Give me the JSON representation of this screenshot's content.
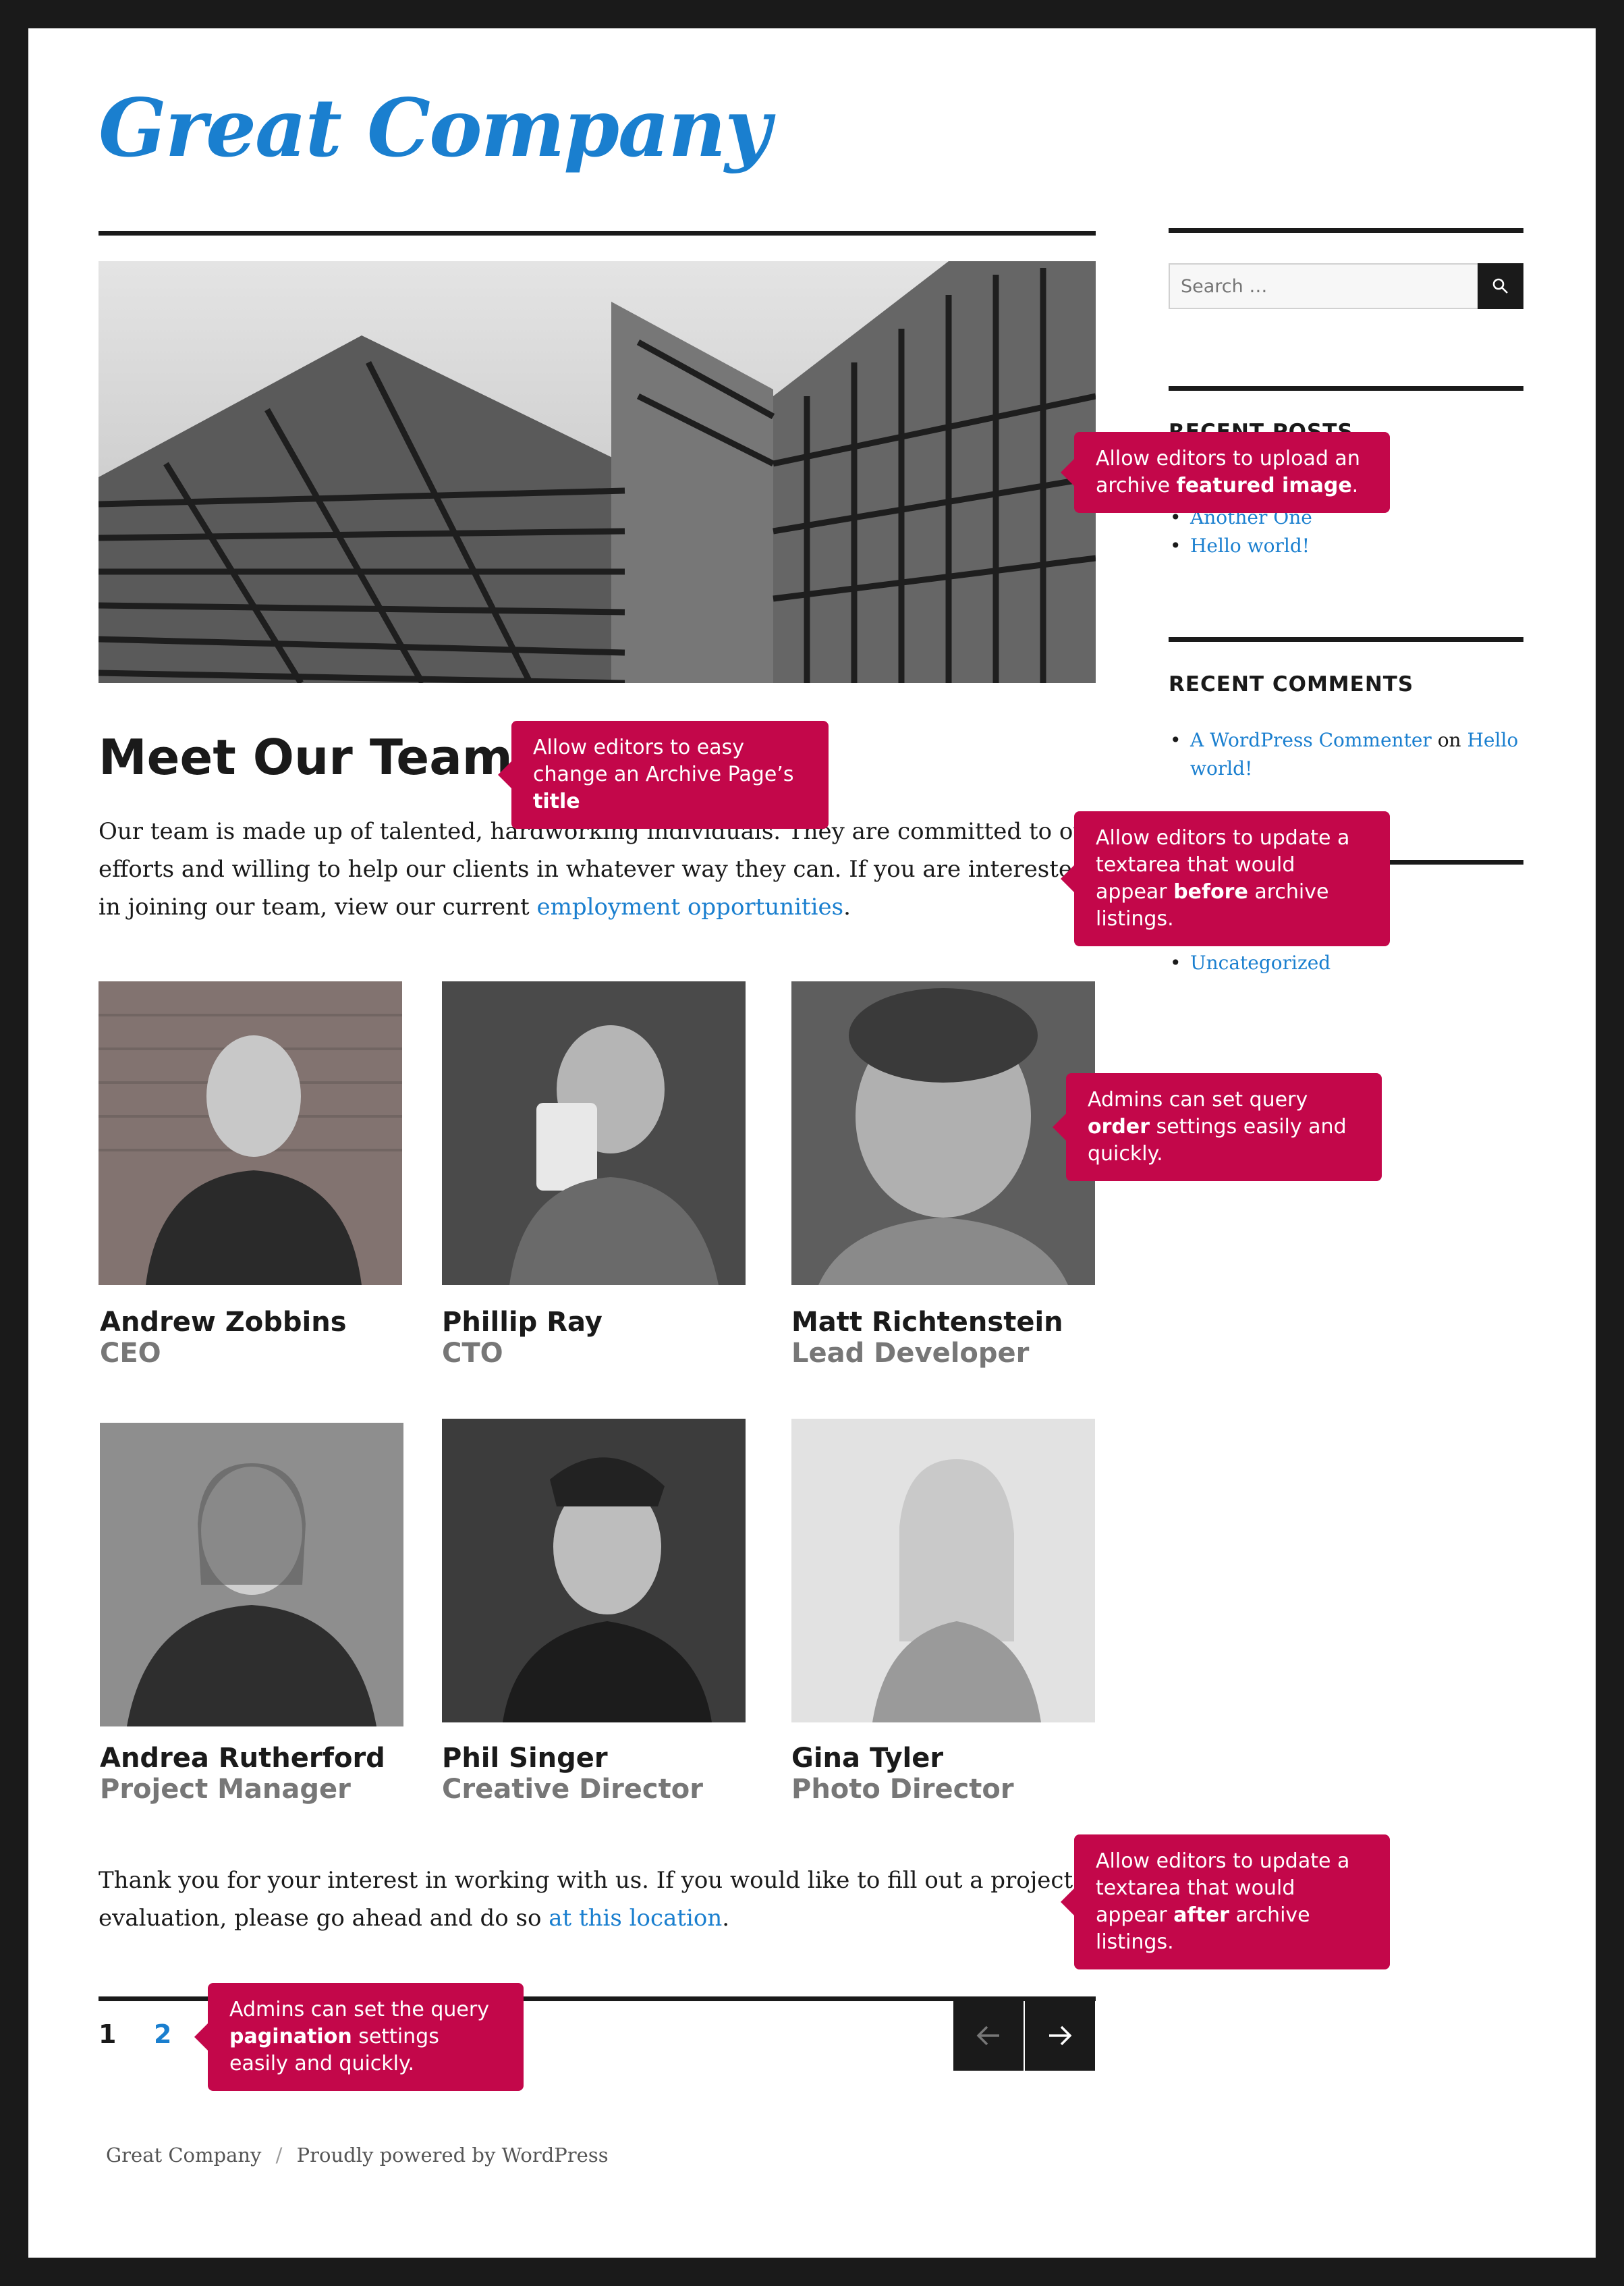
{
  "site": {
    "logo": "Great Company"
  },
  "main": {
    "title": "Meet Our Team",
    "intro_text": "Our team is made up of talented, hardworking individuals. They are committed to our efforts and willing to help our clients in whatever way they can. If you are interested in joining our team, view our current ",
    "intro_link": "employment opportunities",
    "intro_end": ".",
    "team": [
      {
        "name": "Andrew Zobbins",
        "role": "CEO"
      },
      {
        "name": "Phillip Ray",
        "role": "CTO"
      },
      {
        "name": "Matt Richtenstein",
        "role": "Lead Developer"
      },
      {
        "name": "Andrea Rutherford",
        "role": "Project Manager"
      },
      {
        "name": "Phil Singer",
        "role": "Creative Director"
      },
      {
        "name": "Gina Tyler",
        "role": "Photo Director"
      }
    ],
    "outro_text": "Thank you for your interest in working with us. If you would like to fill out a project evaluation, please go ahead and do so ",
    "outro_link": "at this location",
    "outro_end": ".",
    "pagination": {
      "pages": [
        "1",
        "2"
      ],
      "current": "1"
    }
  },
  "sidebar": {
    "search_placeholder": "Search …",
    "recent_posts": {
      "title": "RECENT POSTS",
      "items": [
        "Another One",
        "Hello world!"
      ]
    },
    "recent_comments": {
      "title": "RECENT COMMENTS",
      "author": "A WordPress Commenter",
      "on": "on",
      "post": "Hello world!"
    },
    "categories": {
      "items": [
        "Uncategorized"
      ]
    }
  },
  "footer": {
    "site": "Great Company",
    "sep": "/",
    "powered": "Proudly powered by WordPress"
  },
  "callouts": {
    "featured_image": {
      "pre": "Allow editors to upload an archive ",
      "bold": "featured image",
      "post": "."
    },
    "title": {
      "pre": "Allow editors to easy change an Archive Page’s ",
      "bold": "title",
      "post": ""
    },
    "before": {
      "pre": "Allow editors to update a textarea that would appear ",
      "bold": "before",
      "post": " archive listings."
    },
    "order": {
      "pre": "Admins can set query ",
      "bold": "order",
      "post": " settings easily and quickly."
    },
    "after": {
      "pre": "Allow editors to update a textarea that would appear ",
      "bold": "after",
      "post": " archive listings."
    },
    "pagination": {
      "pre": "Admins can set the query ",
      "bold": "pagination",
      "post": " settings easily and quickly."
    }
  },
  "colors": {
    "accent": "#1a7fcf",
    "callout": "#c3074a",
    "dark": "#1a1a1a"
  }
}
